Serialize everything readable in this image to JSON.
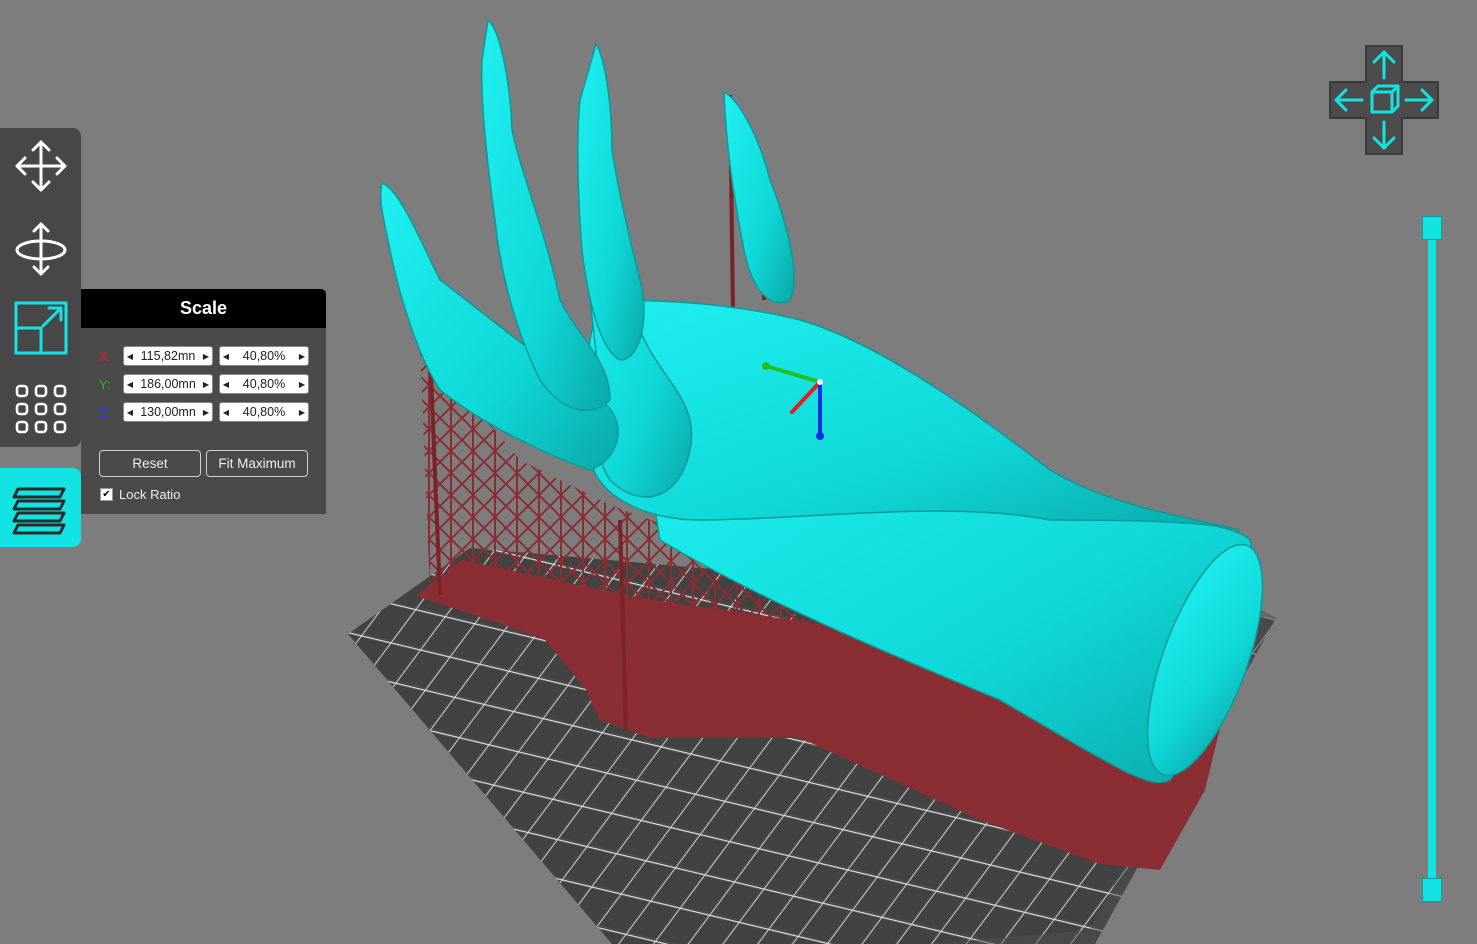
{
  "colors": {
    "background": "#7d7d7d",
    "accent": "#13e3e3",
    "model": "#12e6e6",
    "supports": "#8b2e33",
    "panel_bg": "#4a4a4a",
    "panel_title_bg": "#000000",
    "axis_x": "#e02020",
    "axis_y": "#20c020",
    "axis_z": "#2040e0"
  },
  "toolbar": {
    "tools": [
      {
        "name": "move",
        "icon": "move-arrows-icon",
        "active": false
      },
      {
        "name": "rotate",
        "icon": "rotate-icon",
        "active": false
      },
      {
        "name": "scale",
        "icon": "scale-icon",
        "active": true
      },
      {
        "name": "arrange",
        "icon": "grid-dots-icon",
        "active": false
      }
    ],
    "layers_icon": "layers-icon"
  },
  "scale_panel": {
    "title": "Scale",
    "rows": [
      {
        "axis": "X:",
        "size": "115,82mn",
        "percent": "40,80%"
      },
      {
        "axis": "Y:",
        "size": "186,00mn",
        "percent": "40,80%"
      },
      {
        "axis": "Z:",
        "size": "130,00mn",
        "percent": "40,80%"
      }
    ],
    "reset_label": "Reset",
    "fit_label": "Fit Maximum",
    "lock_label": "Lock Ratio",
    "lock_checked": true
  },
  "view_cube": {
    "icon": "view-cube-nav-icon"
  },
  "layer_slider": {
    "min_handle": "slider-handle-bottom",
    "max_handle": "slider-handle-top"
  }
}
